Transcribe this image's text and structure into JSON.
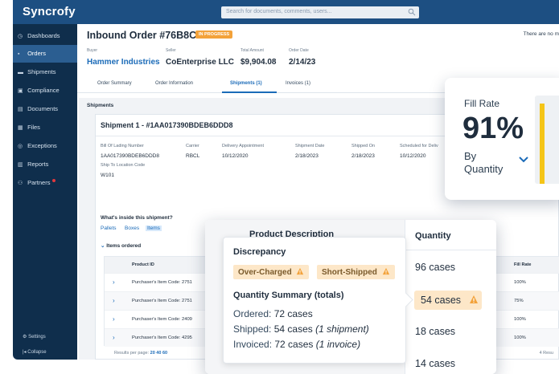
{
  "app": {
    "logo": "Syncrofy",
    "search_placeholder": "Search for documents, comments, users..."
  },
  "sidebar": {
    "items": [
      {
        "icon": "dashboard-icon",
        "glyph": "◷",
        "label": "Dashboards"
      },
      {
        "icon": "orders-icon",
        "glyph": "🛒",
        "label": "Orders"
      },
      {
        "icon": "truck-icon",
        "glyph": "⛟",
        "label": "Shipments"
      },
      {
        "icon": "compliance-icon",
        "glyph": "▣",
        "label": "Compliance"
      },
      {
        "icon": "documents-icon",
        "glyph": "▤",
        "label": "Documents"
      },
      {
        "icon": "files-icon",
        "glyph": "▦",
        "label": "Files"
      },
      {
        "icon": "exceptions-icon",
        "glyph": "◎",
        "label": "Exceptions"
      },
      {
        "icon": "reports-icon",
        "glyph": "▥",
        "label": "Reports"
      },
      {
        "icon": "partners-icon",
        "glyph": "⚇",
        "label": "Partners"
      }
    ],
    "settings": "Settings",
    "collapse": "Collapse",
    "settings_glyph": "⚙",
    "collapse_glyph": "|◂"
  },
  "order": {
    "title": "Inbound Order #76B8C2E",
    "status": "IN PROGRESS",
    "no_more": "There are no m",
    "buyer_label": "Buyer",
    "buyer": "Hammer Industries",
    "seller_label": "Seller",
    "seller": "CoEnterprise LLC",
    "total_label": "Total Amount",
    "total": "$9,904.08",
    "date_label": "Order Date",
    "date": "2/14/23"
  },
  "tabs": [
    "Order Summary",
    "Order Information",
    "Shipments (1)",
    "Invoices (1)"
  ],
  "shipments": {
    "section_title": "Shipments",
    "ship_title": "Shipment 1 - #1AA017390BDEB6DDD8",
    "fields": {
      "bol_label": "Bill Of Lading Number",
      "bol": "1AA017390BDEB6DDD8",
      "carrier_label": "Carrier",
      "carrier": "RBCL",
      "appt_label": "Delivery Appointment",
      "appt": "10/12/2020",
      "shipdate_label": "Shipment Date",
      "shipdate": "2/18/2023",
      "shippedon_label": "Shipped On",
      "shippedon": "2/18/2023",
      "sched_label": "Scheduled for Deliv",
      "sched": "10/12/2020",
      "loc_label": "Ship To Location Code",
      "loc": "W101"
    },
    "inside_title": "What's inside this shipment?",
    "options": [
      "Pallets",
      "Boxes",
      "Items"
    ],
    "items_ordered": "Items ordered",
    "table": {
      "headers": [
        "Product ID",
        "Fill Rate"
      ],
      "rows": [
        {
          "product": "Purchaser's Item Code: 2751",
          "fill": "100%"
        },
        {
          "product": "Purchaser's Item Code: 2751",
          "fill": "75%"
        },
        {
          "product": "Purchaser's Item Code: 2409",
          "fill": "100%"
        },
        {
          "product": "Purchaser's Item Code: 4295",
          "fill": "100%"
        }
      ]
    },
    "results_per_page": "Results per page:",
    "rpp_options": [
      "20",
      "40",
      "60"
    ],
    "results_count": "4 Resu"
  },
  "fill_rate": {
    "label": "Fill Rate",
    "value": "91%",
    "by": "By Quantity",
    "bar_fraction": 0.91,
    "bar_color": "#f5c518"
  },
  "discrepancy": {
    "product_description": "Product Description",
    "quantity_header": "Quantity",
    "quantities": [
      "96 cases",
      "54 cases",
      "18 cases",
      "14 cases"
    ],
    "title": "Discrepancy",
    "chips": [
      "Over-Charged",
      "Short-Shipped"
    ],
    "summary_title": "Quantity Summary (totals)",
    "ordered_label": "Ordered:",
    "ordered": "72 cases",
    "shipped_label": "Shipped:",
    "shipped": "54 cases",
    "shipped_note": "(1 shipment)",
    "invoiced_label": "Invoiced:",
    "invoiced": "72 cases",
    "invoiced_note": "(1 invoice)",
    "warning_color": "#f3a23a"
  }
}
